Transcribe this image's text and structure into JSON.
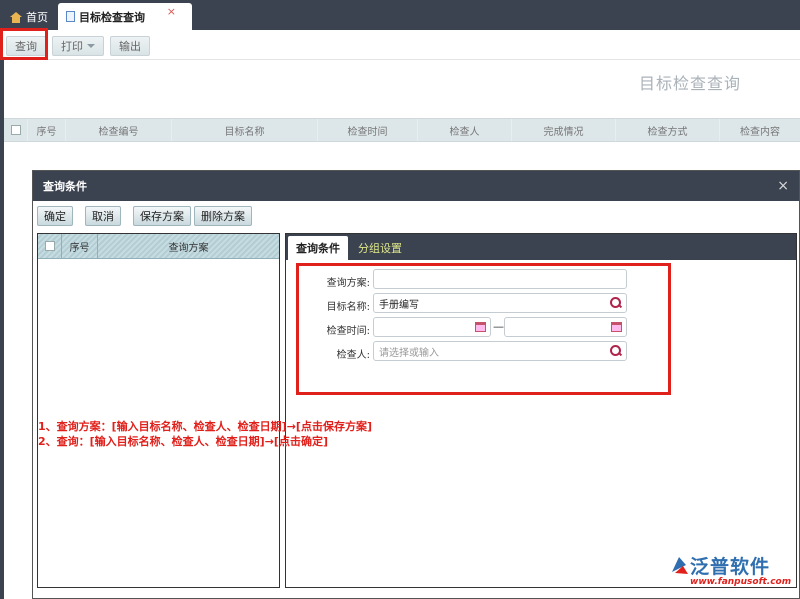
{
  "tabs": {
    "home_label": "首页",
    "active_label": "目标检查查询",
    "close_glyph": "×"
  },
  "toolbar": {
    "query_label": "查询",
    "print_label": "打印",
    "export_label": "输出"
  },
  "page": {
    "title": "目标检查查询"
  },
  "grid": {
    "columns": [
      "序号",
      "检查编号",
      "目标名称",
      "检查时间",
      "检查人",
      "完成情况",
      "检查方式",
      "检查内容"
    ]
  },
  "dialog": {
    "title": "查询条件",
    "close_glyph": "×",
    "buttons": {
      "confirm": "确定",
      "cancel": "取消",
      "save_scheme": "保存方案",
      "delete_scheme": "删除方案"
    },
    "scheme_list": {
      "columns": [
        "序号",
        "查询方案"
      ]
    },
    "tabs": {
      "conditions": "查询条件",
      "grouping": "分组设置"
    },
    "form": {
      "scheme_label": "查询方案:",
      "scheme_value": "",
      "target_name_label": "目标名称:",
      "target_name_value": "手册编写",
      "check_time_label": "检查时间:",
      "check_time_from": "",
      "check_time_separator": "—",
      "check_time_to": "",
      "inspector_label": "检查人:",
      "inspector_placeholder": "请选择或输入"
    }
  },
  "annotations": {
    "line1": "1、查询方案：[输入目标名称、检查人、检查日期]→[点击保存方案]",
    "line2": "2、查询：[输入目标名称、检查人、检查日期]→[点击确定]"
  },
  "watermark": {
    "brand": "泛普软件",
    "url": "www.fanpusoft.com"
  },
  "colors": {
    "chrome_dark": "#3c4350",
    "highlight_red": "#e0201b",
    "brand_blue": "#2f6fb0",
    "tab_inactive_text": "#dfe78a"
  }
}
